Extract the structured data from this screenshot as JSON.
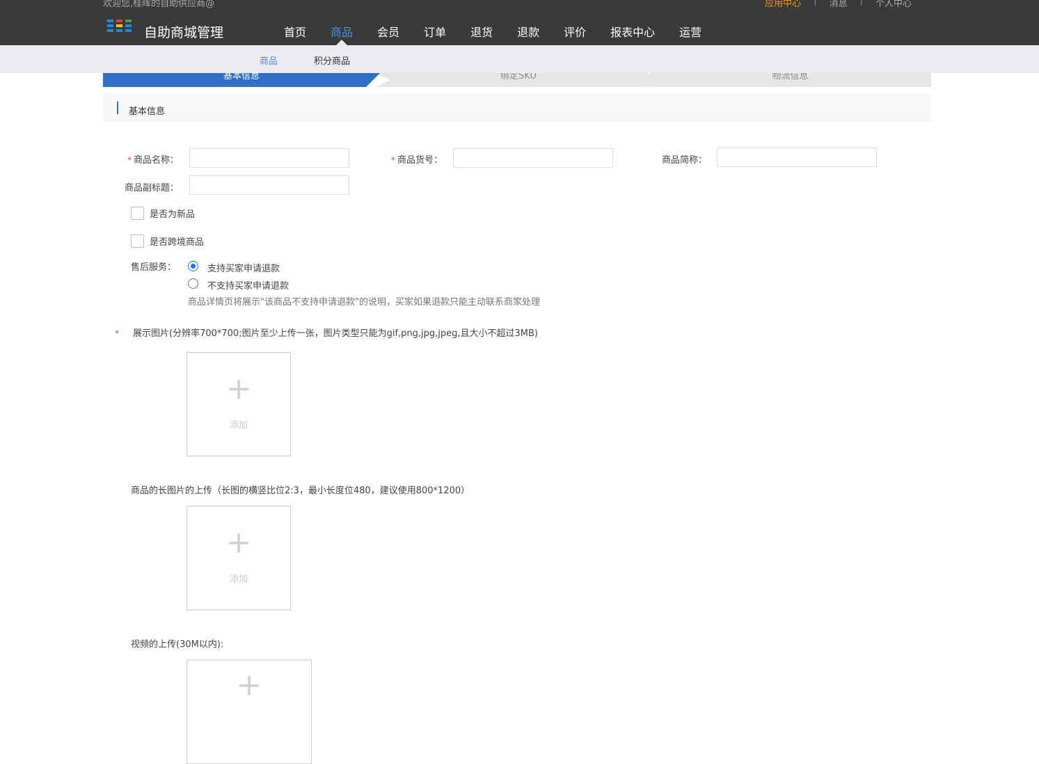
{
  "header": {
    "welcome": "欢迎您,桂晖的自助供应商@",
    "top_links": [
      "应用中心",
      "消息",
      "个人中心"
    ],
    "brand": "自助商城管理",
    "logo_colors": [
      "#1e88e5",
      "#e53935",
      "#43a047",
      "#1e88e5",
      "#fbc02d",
      "#1e88e5",
      "#1e88e5",
      "#1e88e5",
      "#1e88e5"
    ],
    "nav": [
      "首页",
      "商品",
      "会员",
      "订单",
      "退货",
      "退款",
      "评价",
      "报表中心",
      "运营"
    ],
    "active_nav": "商品"
  },
  "subnav": {
    "items": [
      "商品",
      "积分商品"
    ],
    "active": "商品"
  },
  "steps": [
    "基本信息",
    "绑定SKU",
    "物流信息"
  ],
  "section_title": "基本信息",
  "form": {
    "name_label": "商品名称：",
    "sku_no_label": "商品货号：",
    "short_name_label": "商品简称：",
    "subtitle_label": "商品副标题：",
    "name_value": "",
    "sku_no_value": "",
    "short_name_value": "",
    "subtitle_value": "",
    "is_new_label": "是否为新品",
    "is_crossborder_label": "是否跨境商品",
    "after_sale_label": "售后服务：",
    "after_sale_options": [
      "支持买家申请退款",
      "不支持买家申请退款"
    ],
    "after_sale_selected": "支持买家申请退款",
    "after_sale_hint": "商品详情页将展示\"该商品不支持申请退款\"的说明，买家如果退款只能主动联系商家处理",
    "required_mark": "*"
  },
  "uploads": {
    "display_label": "展示图片(分辨率700*700;图片至少上传一张，图片类型只能为gif,png,jpg,jpeg,且大小不超过3MB)",
    "long_label": "商品的长图片的上传（长图的横竖比位2:3，最小长度位480，建议使用800*1200）",
    "video_label": "视频的上传(30M以内):",
    "add_text": "添加",
    "plus_symbol": "+"
  }
}
